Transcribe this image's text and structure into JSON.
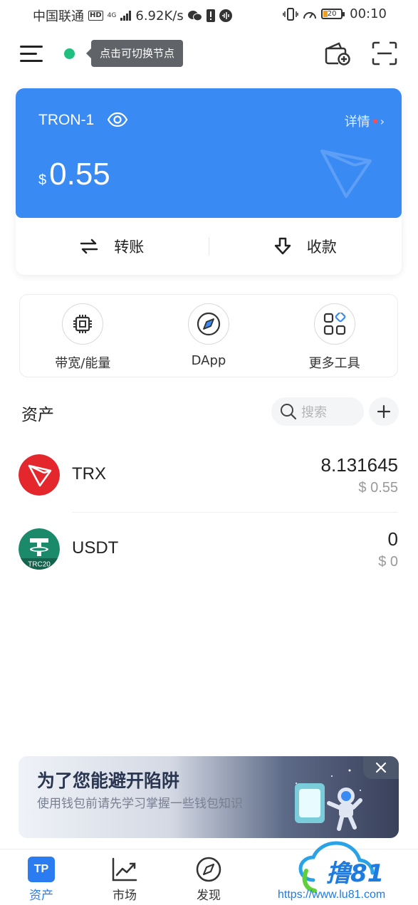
{
  "status_bar": {
    "carrier": "中国联通",
    "hd": "HD",
    "network": "4G",
    "speed": "6.92K/s",
    "battery_level": "20",
    "time": "00:10"
  },
  "header": {
    "node_tooltip": "点击可切换节点",
    "node_status_color": "#1fbf7f"
  },
  "wallet": {
    "name": "TRON-1",
    "details_label": "详情",
    "currency_symbol": "$",
    "balance": "0.55",
    "card_color": "#3a8af4"
  },
  "actions": {
    "transfer_label": "转账",
    "receive_label": "收款"
  },
  "tools": [
    {
      "label": "带宽/能量",
      "icon": "chip-icon"
    },
    {
      "label": "DApp",
      "icon": "compass-icon"
    },
    {
      "label": "更多工具",
      "icon": "grid-icon"
    }
  ],
  "assets": {
    "title": "资产",
    "search_placeholder": "搜索",
    "items": [
      {
        "symbol": "TRX",
        "amount": "8.131645",
        "value": "$ 0.55",
        "logo": "tron-logo"
      },
      {
        "symbol": "USDT",
        "amount": "0",
        "value": "$ 0",
        "logo": "tether-trc20-logo",
        "badge": "TRC20"
      }
    ]
  },
  "banner": {
    "title": "为了您能避开陷阱",
    "subtitle": "使用钱包前请先学习掌握一些钱包知识"
  },
  "tabbar": {
    "items": [
      {
        "label": "资产",
        "active": true
      },
      {
        "label": "市场",
        "active": false
      },
      {
        "label": "发现",
        "active": false
      }
    ],
    "accent": "#2a7cf0"
  },
  "watermark": {
    "logo_text": "撸81",
    "url": "https://www.lu81.com"
  }
}
